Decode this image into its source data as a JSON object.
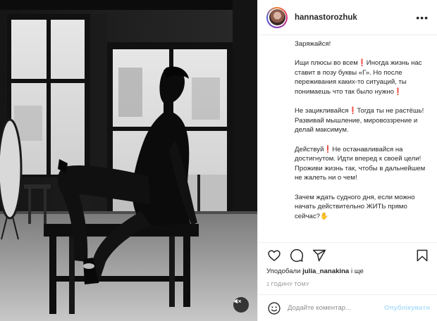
{
  "post": {
    "username": "hannastorozhuk",
    "more_label": "•••",
    "caption_paragraphs": [
      "Заряжайся!",
      "Ищи плюсы во всем❗Иногда жизнь нас ставит в позу буквы «Г». Но после переживания каких-то ситуаций, ты понимаешь что так было нужно❗",
      "Не зацикливайся❗Тогда ты не растёшь! Развивай мышление, мировоззрение и делай максимум.",
      "Действуй❗Не останавливайся на достигнутом. Идти вперед к своей цели! Проживи жизнь так, чтобы в дальнейшем не жалеть ни о чем!",
      "Зачем ждать судного дня, если можно начать действительно ЖИТЬ прямо сейчас?✋"
    ],
    "likes_prefix": "Уподобали ",
    "likes_user": "julia_nanakina",
    "likes_suffix": " і ще",
    "time": "1 ГОДИНУ ТОМУ",
    "comment_placeholder": "Додайте коментар...",
    "publish_label": "Опублікувати"
  },
  "icons": {
    "like": "heart-icon",
    "comment": "comment-icon",
    "share": "share-icon",
    "save": "bookmark-icon",
    "emoji": "emoji-icon",
    "sound": "speaker-muted-icon"
  },
  "colors": {
    "text": "#262626",
    "muted": "#8e8e8e",
    "publish_disabled": "#b2dffc",
    "divider": "#efefef"
  }
}
